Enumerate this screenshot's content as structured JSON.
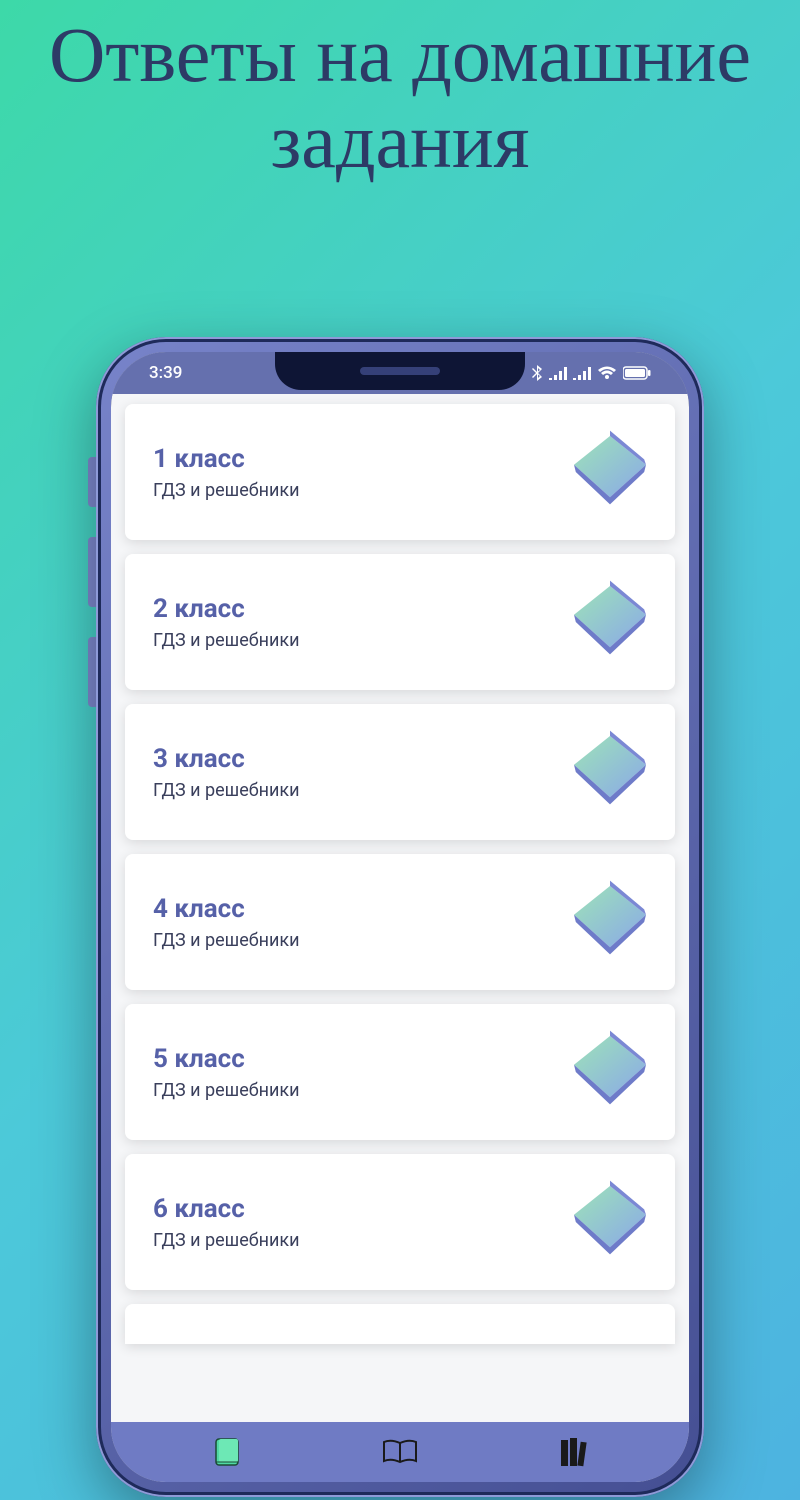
{
  "headline": "Ответы на домашние задания",
  "status": {
    "time": "3:39"
  },
  "cards": [
    {
      "title": "1 класс",
      "sub": "ГДЗ и решебники"
    },
    {
      "title": "2 класс",
      "sub": "ГДЗ и решебники"
    },
    {
      "title": "3 класс",
      "sub": "ГДЗ и решебники"
    },
    {
      "title": "4 класс",
      "sub": "ГДЗ и решебники"
    },
    {
      "title": "5 класс",
      "sub": "ГДЗ и решебники"
    },
    {
      "title": "6 класс",
      "sub": "ГДЗ и решебники"
    }
  ],
  "colors": {
    "accent": "#6570ae",
    "titleColor": "#5661a8"
  }
}
